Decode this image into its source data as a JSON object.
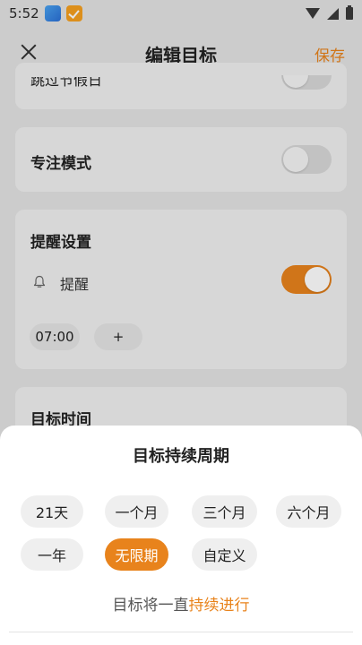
{
  "status_bar": {
    "time": "5:52"
  },
  "header": {
    "title": "编辑目标",
    "save_label": "保存"
  },
  "cards": {
    "skip_holidays_label": "跳过节假日",
    "focus_mode_label": "专注模式",
    "reminder": {
      "title": "提醒设置",
      "toggle_label": "提醒",
      "enabled": true,
      "time_chip": "07:00",
      "add_chip": "+"
    },
    "goal_time_title": "目标时间"
  },
  "sheet": {
    "title": "目标持续周期",
    "options": [
      "21天",
      "一个月",
      "三个月",
      "六个月",
      "一年",
      "无限期",
      "自定义"
    ],
    "selected": "无限期",
    "description_prefix": "目标将一直",
    "description_highlight": "持续进行"
  },
  "colors": {
    "accent": "#e8831c",
    "background": "#e4e4e4",
    "card": "#f0f0f0"
  }
}
